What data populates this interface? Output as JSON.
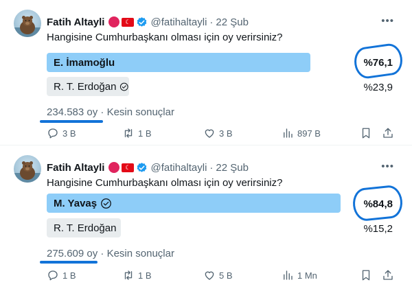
{
  "tweets": [
    {
      "author": {
        "name": "Fatih Altayli",
        "handle": "@fatihaltayli",
        "date": "22 Şub"
      },
      "question": "Hangisine Cumhurbaşkanı olması için oy verirsiniz?",
      "options": [
        {
          "label": "E. İmamoğlu",
          "percent": "%76,1",
          "value": 76.1,
          "winner": true
        },
        {
          "label": "R. T. Erdoğan",
          "percent": "%23,9",
          "value": 23.9,
          "winner": false
        }
      ],
      "votes": "234.583 oy",
      "status": "Kesin sonuçlar",
      "actions": {
        "reply": "3 B",
        "retweet": "1 B",
        "like": "3 B",
        "views": "897 B"
      }
    },
    {
      "author": {
        "name": "Fatih Altayli",
        "handle": "@fatihaltayli",
        "date": "22 Şub"
      },
      "question": "Hangisine Cumhurbaşkanı olması için oy verirsiniz?",
      "options": [
        {
          "label": "M. Yavaş",
          "percent": "%84,8",
          "value": 84.8,
          "winner": true
        },
        {
          "label": "R. T. Erdoğan",
          "percent": "%15,2",
          "value": 15.2,
          "winner": false
        }
      ],
      "votes": "275.609 oy",
      "status": "Kesin sonuçlar",
      "actions": {
        "reply": "1 B",
        "retweet": "1 B",
        "like": "5 B",
        "views": "1 Mn"
      }
    }
  ],
  "colors": {
    "winner_bar": "#8ecdf8",
    "loser_bar": "#e8ecee",
    "annotation": "#1273d8",
    "verified": "#1d9bf0"
  },
  "icons": [
    "bear-avatar",
    "red-circle",
    "turkish-flag",
    "verified-badge",
    "more-icon",
    "check-circle-icon",
    "reply-icon",
    "retweet-icon",
    "like-icon",
    "views-icon",
    "bookmark-icon",
    "share-icon"
  ]
}
